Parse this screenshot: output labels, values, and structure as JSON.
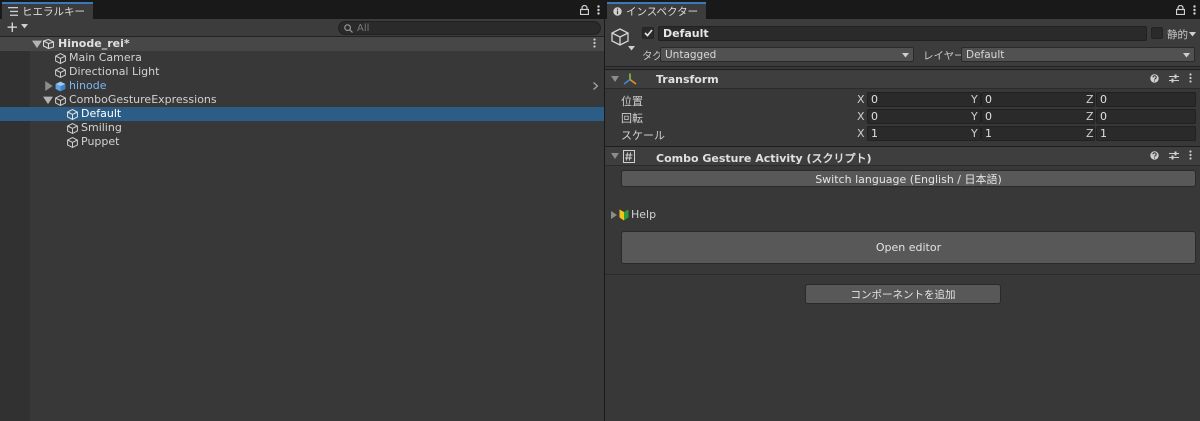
{
  "hierarchy": {
    "tab_label": "ヒエラルキー",
    "search_placeholder": "All",
    "scene_name": "Hinode_rei*",
    "items": [
      {
        "label": "Main Camera"
      },
      {
        "label": "Directional Light"
      },
      {
        "label": "hinode"
      },
      {
        "label": "ComboGestureExpressions"
      },
      {
        "label": "Default"
      },
      {
        "label": "Smiling"
      },
      {
        "label": "Puppet"
      }
    ]
  },
  "inspector": {
    "tab_label": "インスペクター",
    "object": {
      "name": "Default",
      "static_label": "静的",
      "tag_label": "タグ",
      "tag_value": "Untagged",
      "layer_label": "レイヤー",
      "layer_value": "Default"
    },
    "transform": {
      "title": "Transform",
      "rows": [
        {
          "label": "位置",
          "x": "0",
          "y": "0",
          "z": "0"
        },
        {
          "label": "回転",
          "x": "0",
          "y": "0",
          "z": "0"
        },
        {
          "label": "スケール",
          "x": "1",
          "y": "1",
          "z": "1"
        }
      ],
      "axis_x": "X",
      "axis_y": "Y",
      "axis_z": "Z"
    },
    "script": {
      "title": "Combo Gesture Activity (スクリプト)",
      "switch_language_label": "Switch language (English / 日本語)",
      "help_label": "Help",
      "open_editor_label": "Open editor"
    },
    "add_component_label": "コンポーネントを追加"
  }
}
